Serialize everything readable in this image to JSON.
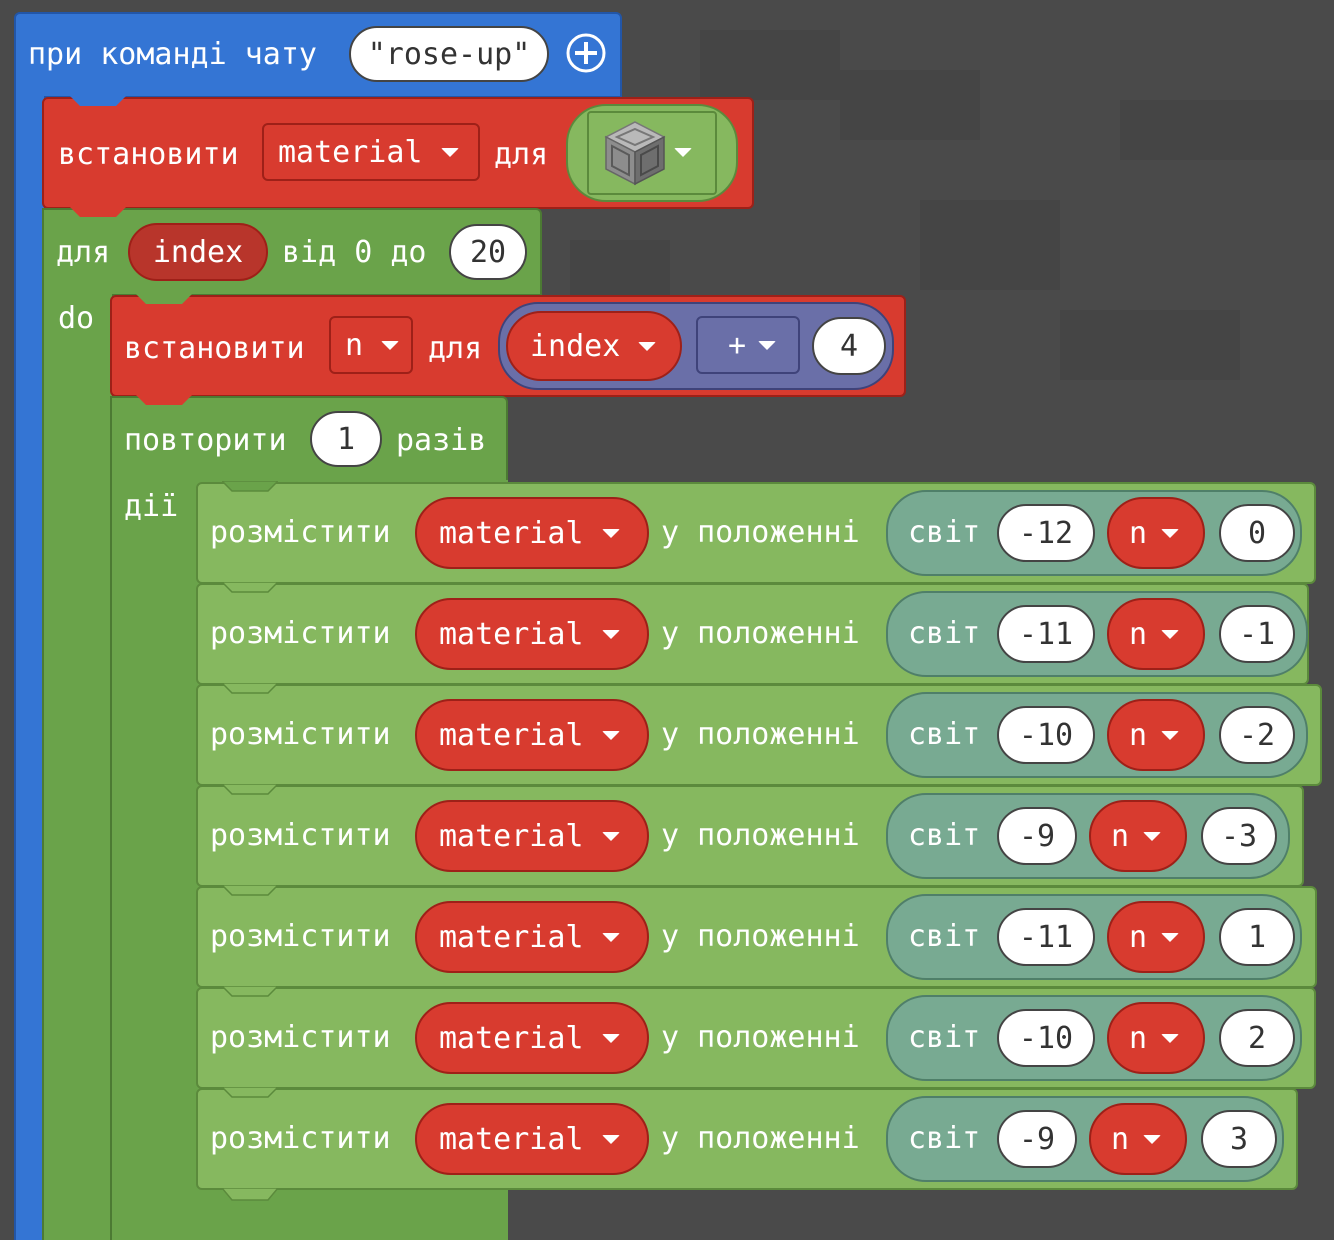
{
  "event": {
    "label": "при команді чату",
    "command": "\"rose-up\"",
    "add_icon": "plus-circle-icon"
  },
  "set_material": {
    "label": "встановити",
    "variable": "material",
    "for_label": "для",
    "block_icon": "chiseled-stone-block-icon"
  },
  "for_loop": {
    "label": "для",
    "variable": "index",
    "range_label": "від 0 до",
    "end": "20",
    "do_label": "do"
  },
  "set_n": {
    "label": "встановити",
    "variable": "n",
    "for_label": "для",
    "operand_left": "index",
    "operator": "+",
    "operand_right": "4"
  },
  "repeat": {
    "label": "повторити",
    "count": "1",
    "times_label": "разів",
    "do_label": "дії"
  },
  "place_rows": [
    {
      "place": "розмістити",
      "material": "material",
      "at": "у положенні",
      "world": "світ",
      "x": "-12",
      "y": "n",
      "z": "0"
    },
    {
      "place": "розмістити",
      "material": "material",
      "at": "у положенні",
      "world": "світ",
      "x": "-11",
      "y": "n",
      "z": "-1"
    },
    {
      "place": "розмістити",
      "material": "material",
      "at": "у положенні",
      "world": "світ",
      "x": "-10",
      "y": "n",
      "z": "-2"
    },
    {
      "place": "розмістити",
      "material": "material",
      "at": "у положенні",
      "world": "світ",
      "x": "-9",
      "y": "n",
      "z": "-3"
    },
    {
      "place": "розмістити",
      "material": "material",
      "at": "у положенні",
      "world": "світ",
      "x": "-11",
      "y": "n",
      "z": "1"
    },
    {
      "place": "розмістити",
      "material": "material",
      "at": "у положенні",
      "world": "світ",
      "x": "-10",
      "y": "n",
      "z": "2"
    },
    {
      "place": "розмістити",
      "material": "material",
      "at": "у положенні",
      "world": "світ",
      "x": "-9",
      "y": "n",
      "z": "3"
    }
  ],
  "colors": {
    "event_blue": "#3475d4",
    "variables_red": "#d83b2f",
    "loops_green": "#6aa34a",
    "blocks_green": "#86b85f",
    "position_teal": "#78aa92",
    "math_purple": "#6a6fa8",
    "workspace": "#4a4a4a"
  }
}
